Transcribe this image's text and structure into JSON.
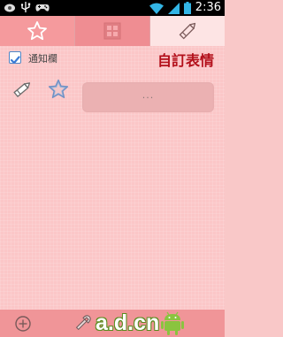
{
  "status_bar": {
    "time": "2:36",
    "icons": [
      "notification-eye-icon",
      "usb-icon",
      "gamepad-icon",
      "wifi-icon",
      "signal-icon",
      "battery-icon"
    ]
  },
  "tabs": [
    {
      "name": "favorites",
      "icon": "star-icon",
      "selected": false
    },
    {
      "name": "grid",
      "icon": "grid-icon",
      "selected": false
    },
    {
      "name": "custom",
      "icon": "pencil-icon",
      "selected": true
    }
  ],
  "notification": {
    "label": "通知欄",
    "checked": true
  },
  "page_title": "自訂表情",
  "entry": {
    "placeholder": "..."
  },
  "bottom_bar": {
    "add_icon": "plus-circle-icon",
    "settings_icon": "wrench-icon"
  },
  "watermark": {
    "text": "a.d.cn",
    "logo": "android-logo"
  },
  "colors": {
    "tab_active": "#fde4e4",
    "tab_1": "#f59a9d",
    "tab_2": "#ef8d92",
    "background": "#fbc6c7",
    "bottom_bar": "#f09598",
    "title": "#b30f1a"
  }
}
